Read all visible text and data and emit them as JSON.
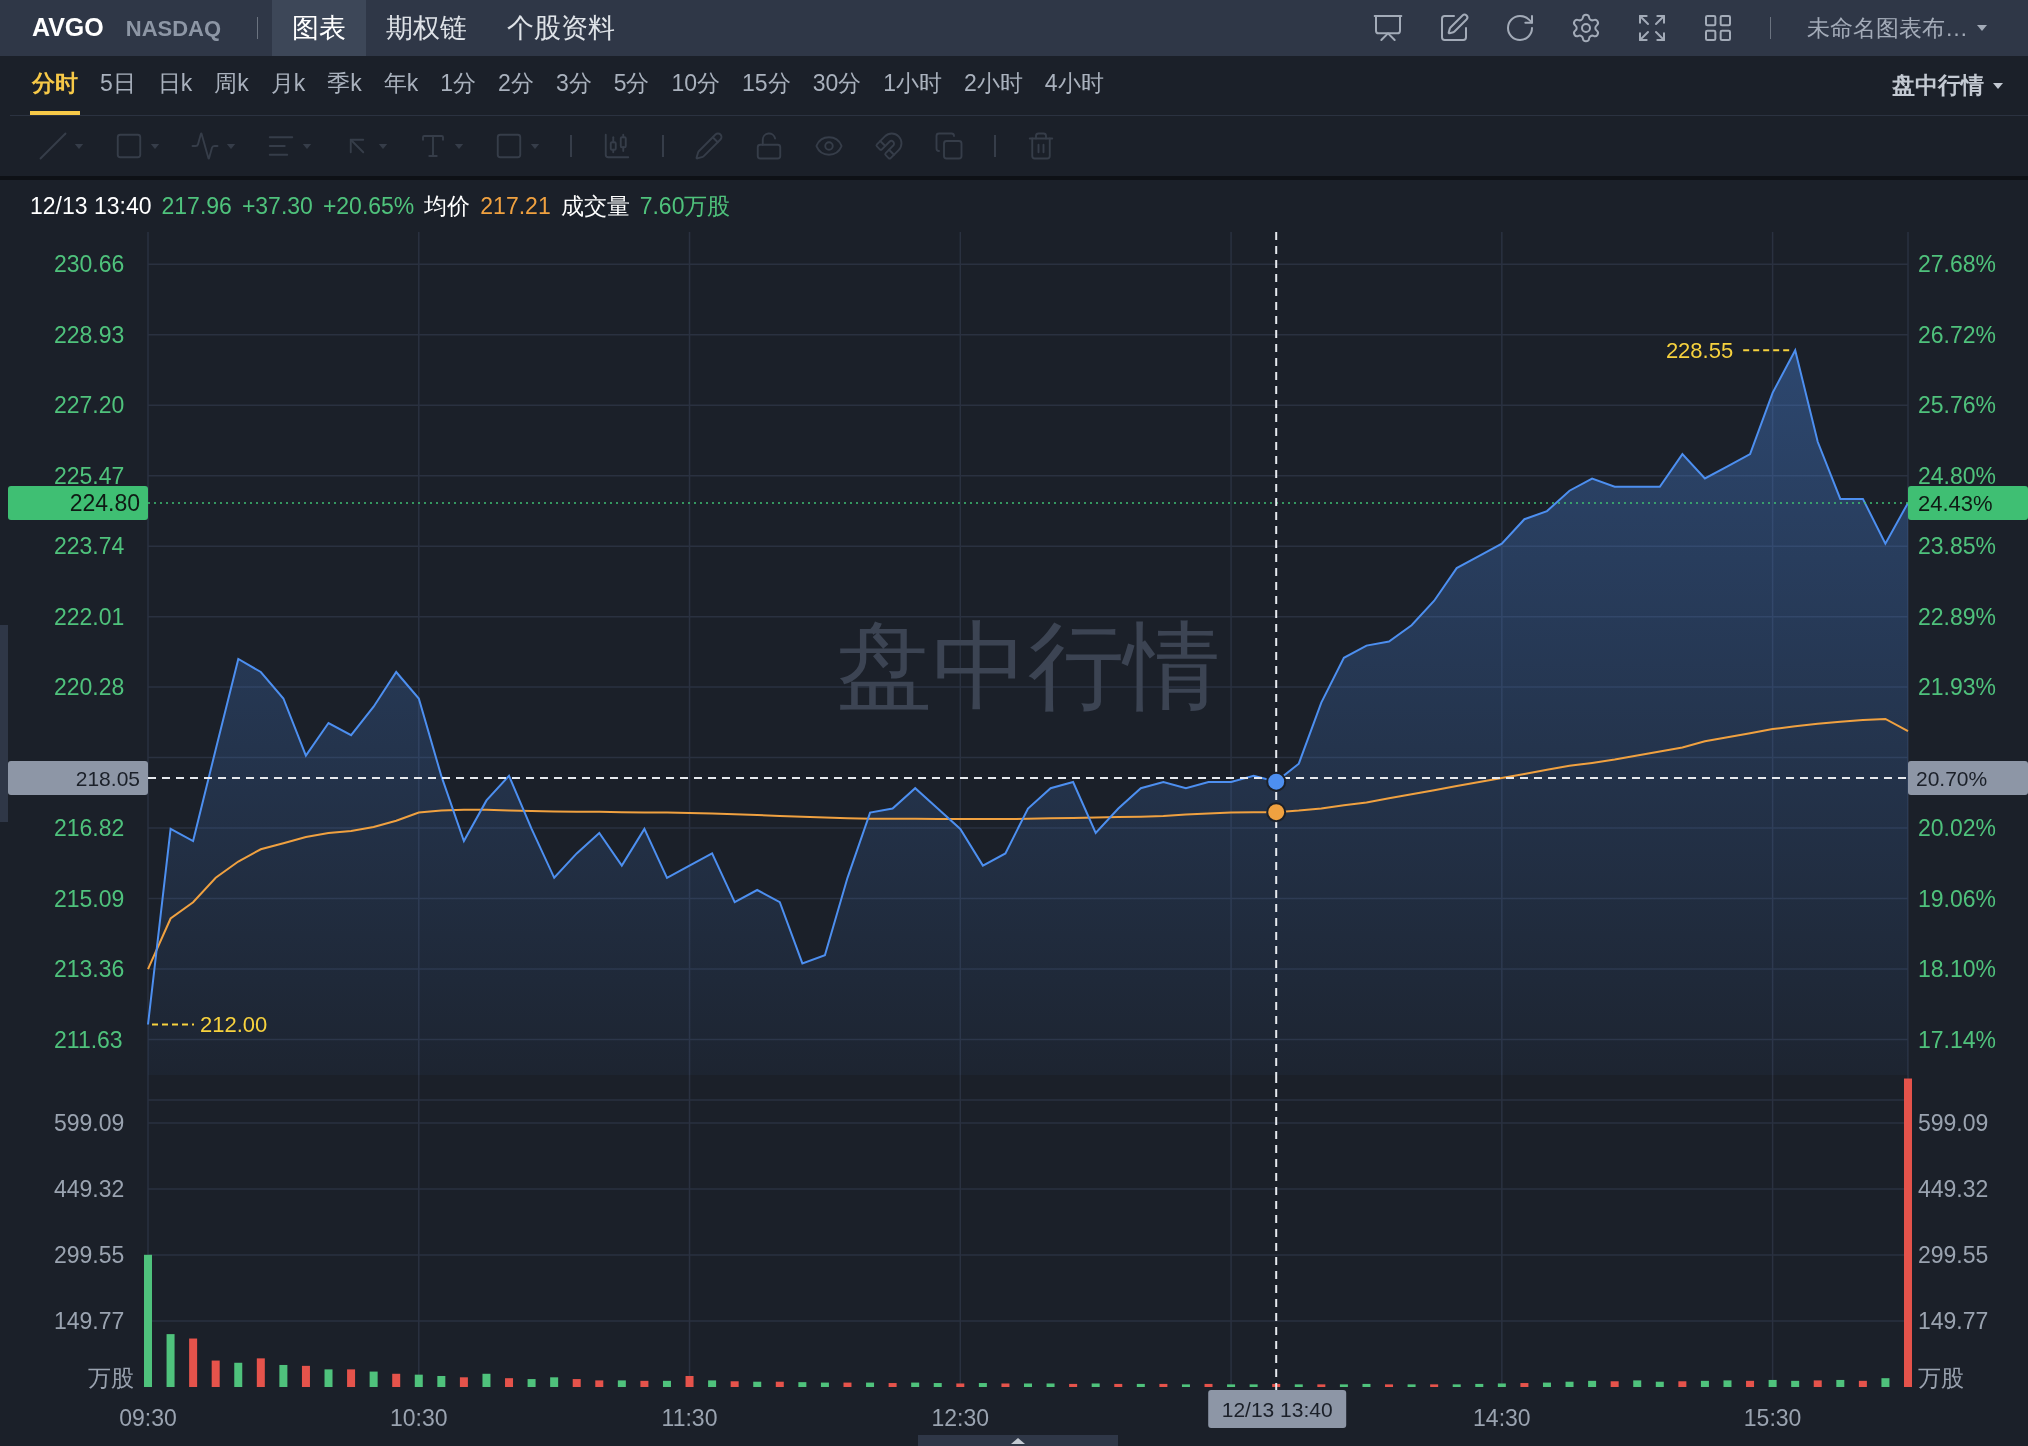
{
  "header": {
    "symbol": "AVGO",
    "exchange": "NASDAQ",
    "tabs": [
      {
        "label": "图表",
        "selected": true
      },
      {
        "label": "期权链",
        "selected": false
      },
      {
        "label": "个股资料",
        "selected": false
      }
    ],
    "layout_menu": "未命名图表布…"
  },
  "timeframes": {
    "items": [
      {
        "label": "分时",
        "selected": true
      },
      {
        "label": "5日",
        "selected": false
      },
      {
        "label": "日k",
        "selected": false
      },
      {
        "label": "周k",
        "selected": false
      },
      {
        "label": "月k",
        "selected": false
      },
      {
        "label": "季k",
        "selected": false
      },
      {
        "label": "年k",
        "selected": false
      },
      {
        "label": "1分",
        "selected": false
      },
      {
        "label": "2分",
        "selected": false
      },
      {
        "label": "3分",
        "selected": false
      },
      {
        "label": "5分",
        "selected": false
      },
      {
        "label": "10分",
        "selected": false
      },
      {
        "label": "15分",
        "selected": false
      },
      {
        "label": "30分",
        "selected": false
      },
      {
        "label": "1小时",
        "selected": false
      },
      {
        "label": "2小时",
        "selected": false
      },
      {
        "label": "4小时",
        "selected": false
      }
    ],
    "session_menu": "盘中行情"
  },
  "info_line": [
    {
      "text": "12/13 13:40",
      "color": "#ffffff"
    },
    {
      "text": "217.96",
      "color": "#4fc27c"
    },
    {
      "text": "+37.30",
      "color": "#4fc27c"
    },
    {
      "text": "+20.65%",
      "color": "#4fc27c"
    },
    {
      "text": "均价",
      "color": "#ffffff"
    },
    {
      "text": "217.21",
      "color": "#f0a140"
    },
    {
      "text": "成交量",
      "color": "#ffffff"
    },
    {
      "text": "7.60万股",
      "color": "#4fc27c"
    }
  ],
  "price_chart": {
    "watermark": "盘中行情",
    "right_axis": {
      "ticks": [
        "27.68%",
        "26.72%",
        "25.76%",
        "24.80%",
        "23.85%",
        "22.89%",
        "21.93%",
        "20.02%",
        "19.06%",
        "18.10%",
        "17.14%"
      ],
      "tags": [
        "24.43%",
        "20.70%"
      ]
    },
    "chart_data": {
      "type": "line",
      "grid": true,
      "ylim": [
        210.76,
        231.45
      ],
      "categories": [
        null,
        null,
        null,
        null,
        null,
        null,
        null,
        null,
        null,
        null,
        null,
        null,
        null,
        null,
        null,
        null,
        null,
        null,
        null,
        null,
        null,
        null,
        null,
        null,
        null,
        null,
        null,
        null,
        null,
        null,
        null,
        null,
        null,
        null,
        null,
        null,
        null,
        null,
        null,
        null,
        null,
        null,
        null,
        null,
        null,
        null,
        null,
        null,
        null,
        null,
        null,
        null,
        null,
        null,
        null,
        null,
        null,
        null,
        null,
        null,
        null,
        null,
        null,
        null,
        null,
        null,
        null,
        null,
        null,
        null,
        null,
        null,
        null,
        null,
        null,
        null,
        null,
        null,
        null
      ],
      "series": [
        {
          "color": "#4d8ff0",
          "values": [
            212.0,
            216.8,
            216.5,
            218.75,
            220.97,
            220.65,
            220.0,
            218.6,
            219.4,
            219.1,
            219.8,
            220.65,
            220.0,
            218.1,
            216.5,
            217.5,
            218.1,
            216.8,
            215.6,
            216.2,
            216.7,
            215.9,
            216.8,
            215.6,
            215.9,
            216.2,
            215.0,
            215.3,
            215.0,
            213.5,
            213.7,
            215.6,
            217.2,
            217.3,
            217.8,
            217.3,
            216.8,
            215.9,
            216.2,
            217.3,
            217.8,
            217.95,
            216.7,
            217.3,
            217.8,
            217.95,
            217.8,
            217.95,
            217.95,
            218.1,
            217.96,
            218.4,
            219.9,
            221.0,
            221.3,
            221.4,
            221.8,
            222.4,
            223.2,
            223.5,
            223.8,
            224.4,
            224.6,
            225.1,
            225.4,
            225.2,
            225.2,
            225.2,
            226.0,
            225.4,
            225.7,
            226.0,
            227.5,
            228.55,
            226.3,
            224.9,
            224.9,
            223.8,
            224.8
          ]
        },
        {
          "color": "#f0a140",
          "values": [
            213.36,
            214.6,
            215.0,
            215.6,
            216.0,
            216.3,
            216.45,
            216.6,
            216.7,
            216.75,
            216.85,
            217.0,
            217.2,
            217.25,
            217.27,
            217.27,
            217.25,
            217.24,
            217.23,
            217.22,
            217.22,
            217.21,
            217.2,
            217.2,
            217.19,
            217.18,
            217.16,
            217.14,
            217.12,
            217.1,
            217.08,
            217.06,
            217.05,
            217.05,
            217.05,
            217.04,
            217.04,
            217.04,
            217.04,
            217.05,
            217.06,
            217.07,
            217.08,
            217.09,
            217.1,
            217.12,
            217.15,
            217.18,
            217.2,
            217.21,
            217.21,
            217.25,
            217.3,
            217.38,
            217.45,
            217.55,
            217.65,
            217.75,
            217.85,
            217.95,
            218.05,
            218.15,
            218.25,
            218.35,
            218.42,
            218.5,
            218.6,
            218.7,
            218.8,
            218.95,
            219.05,
            219.15,
            219.25,
            219.32,
            219.38,
            219.43,
            219.47,
            219.5,
            219.2
          ]
        }
      ],
      "yticks": [
        {
          "value": 230.66,
          "label": "230.66"
        },
        {
          "value": 228.93,
          "label": "228.93"
        },
        {
          "value": 227.2,
          "label": "227.20"
        },
        {
          "value": 225.47,
          "label": "225.47"
        },
        {
          "value": 223.74,
          "label": "223.74"
        },
        {
          "value": 222.01,
          "label": "222.01"
        },
        {
          "value": 220.28,
          "label": "220.28"
        },
        {
          "value": 216.82,
          "label": "216.82"
        },
        {
          "value": 215.09,
          "label": "215.09"
        },
        {
          "value": 213.36,
          "label": "213.36"
        },
        {
          "value": 211.63,
          "label": "211.63"
        }
      ],
      "ref_lines": [
        {
          "axis": "y",
          "value": 224.8,
          "label": "224.80",
          "color": "#3fbf73"
        },
        {
          "axis": "y",
          "value": 218.05,
          "label": "218.05",
          "color": "#e6e9ee"
        }
      ],
      "annotations": [
        "228.55",
        "212.00"
      ]
    }
  },
  "volume_chart": {
    "right_axis": {
      "ticks": [
        "599.09",
        "449.32",
        "299.55",
        "149.77"
      ],
      "unit": "万股"
    },
    "crosshair_time": "12/13 13:40",
    "chart_data": {
      "type": "bar",
      "grid": true,
      "ylabel": "万股",
      "ylim": [
        0,
        708
      ],
      "categories": [
        "09:30",
        null,
        null,
        null,
        null,
        null,
        null,
        null,
        null,
        null,
        null,
        null,
        "10:30",
        null,
        null,
        null,
        null,
        null,
        null,
        null,
        null,
        null,
        null,
        null,
        "11:30",
        null,
        null,
        null,
        null,
        null,
        null,
        null,
        null,
        null,
        null,
        null,
        "12:30",
        null,
        null,
        null,
        null,
        null,
        null,
        null,
        null,
        null,
        null,
        null,
        null,
        null,
        null,
        null,
        null,
        null,
        null,
        null,
        null,
        null,
        null,
        null,
        "14:30",
        null,
        null,
        null,
        null,
        null,
        null,
        null,
        null,
        null,
        null,
        null,
        "15:30",
        null,
        null,
        null,
        null,
        null,
        null
      ],
      "series": [
        {
          "color": "#4fc27c",
          "values": [
            300,
            120,
            null,
            null,
            55,
            null,
            50,
            null,
            40,
            null,
            35,
            null,
            28,
            25,
            null,
            30,
            null,
            18,
            22,
            null,
            null,
            15,
            null,
            14,
            null,
            15,
            null,
            12,
            null,
            11,
            10,
            null,
            10,
            null,
            10,
            9,
            null,
            9,
            null,
            8,
            8,
            null,
            8,
            null,
            7,
            null,
            6,
            null,
            6,
            6,
            null,
            6,
            null,
            6,
            7,
            null,
            6,
            null,
            6,
            7,
            8,
            null,
            10,
            12,
            14,
            null,
            15,
            12,
            null,
            14,
            15,
            null,
            16,
            14,
            null,
            16,
            null,
            20,
            null
          ]
        },
        {
          "color": "#e5534b",
          "values": [
            null,
            null,
            110,
            60,
            null,
            65,
            null,
            48,
            null,
            40,
            null,
            30,
            null,
            null,
            22,
            null,
            20,
            null,
            null,
            18,
            15,
            null,
            14,
            null,
            25,
            null,
            13,
            null,
            12,
            null,
            null,
            10,
            null,
            9,
            null,
            null,
            8,
            null,
            8,
            null,
            null,
            7,
            null,
            7,
            null,
            7,
            null,
            7,
            null,
            null,
            7,
            null,
            6,
            null,
            null,
            6,
            null,
            6,
            null,
            null,
            null,
            9,
            null,
            null,
            null,
            13,
            null,
            null,
            13,
            null,
            null,
            14,
            null,
            null,
            15,
            null,
            14,
            null,
            700
          ]
        }
      ],
      "yticks": [
        {
          "value": 599.09,
          "label": "599.09"
        },
        {
          "value": 449.32,
          "label": "449.32"
        },
        {
          "value": 299.55,
          "label": "299.55"
        },
        {
          "value": 149.77,
          "label": "149.77"
        }
      ]
    }
  }
}
